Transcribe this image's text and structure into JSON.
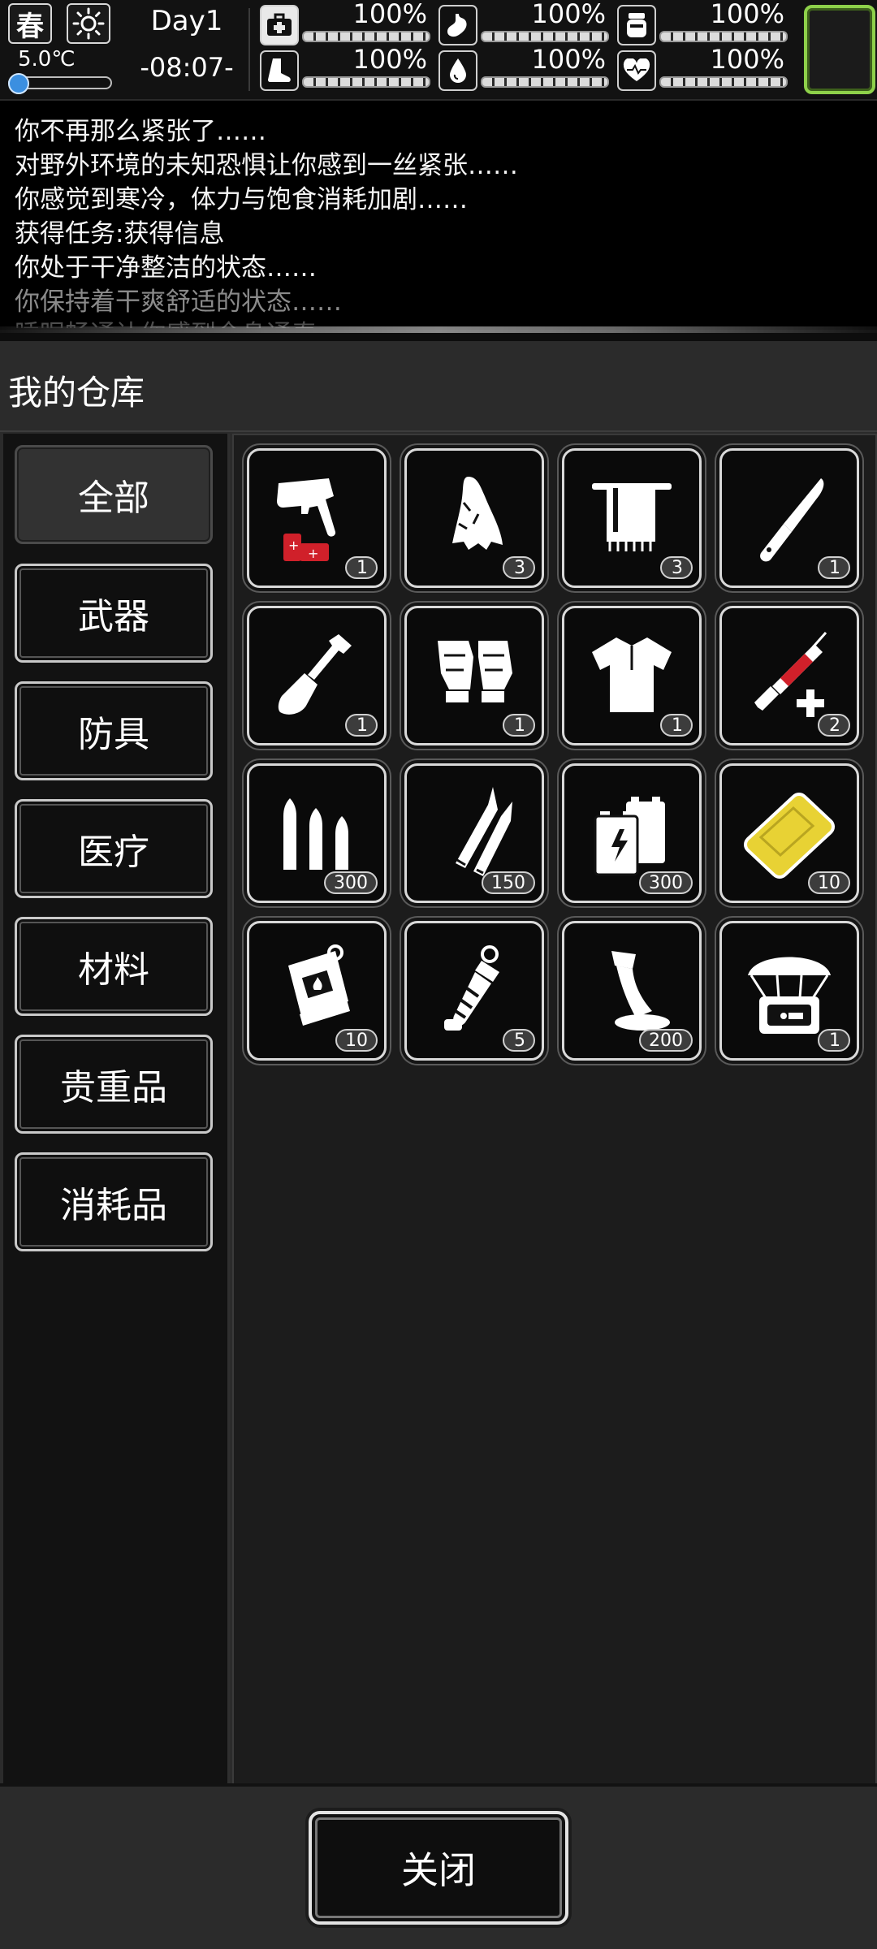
{
  "status": {
    "season": "春",
    "weather_icon": "sun-icon",
    "temperature": "5.0℃",
    "temperature_level": 0.18,
    "day": "Day1",
    "time": "-08:07-",
    "stats": [
      {
        "icon": "first-aid-icon",
        "value": "100%"
      },
      {
        "icon": "stomach-icon",
        "value": "100%"
      },
      {
        "icon": "jar-icon",
        "value": "100%"
      },
      {
        "icon": "boot-icon",
        "value": "100%"
      },
      {
        "icon": "water-drop-icon",
        "value": "100%"
      },
      {
        "icon": "heart-icon",
        "value": "100%"
      }
    ]
  },
  "log": [
    "你不再那么紧张了……",
    "对野外环境的未知恐惧让你感到一丝紧张……",
    "你感觉到寒冷，体力与饱食消耗加剧……",
    "获得任务:获得信息",
    "你处于干净整洁的状态……",
    "你保持着干爽舒适的状态……",
    "睡眠畅通让你感到全身通泰"
  ],
  "warehouse": {
    "title": "我的仓库",
    "categories": [
      "全部",
      "武器",
      "防具",
      "医疗",
      "材料",
      "贵重品",
      "消耗品"
    ],
    "active_category": "全部",
    "items": [
      {
        "icon": "flare-gun-icon",
        "qty": "1"
      },
      {
        "icon": "torn-cloth-icon",
        "qty": "3"
      },
      {
        "icon": "towel-icon",
        "qty": "3"
      },
      {
        "icon": "knife-icon",
        "qty": "1"
      },
      {
        "icon": "shovel-icon",
        "qty": "1"
      },
      {
        "icon": "gloves-icon",
        "qty": "1"
      },
      {
        "icon": "shirt-icon",
        "qty": "1"
      },
      {
        "icon": "syringe-icon",
        "qty": "2"
      },
      {
        "icon": "bullets-icon",
        "qty": "300"
      },
      {
        "icon": "rifle-rounds-icon",
        "qty": "150"
      },
      {
        "icon": "battery-icon",
        "qty": "300"
      },
      {
        "icon": "gold-bar-icon",
        "qty": "10"
      },
      {
        "icon": "fuel-can-icon",
        "qty": "10"
      },
      {
        "icon": "grenade-icon",
        "qty": "5"
      },
      {
        "icon": "glue-icon",
        "qty": "200"
      },
      {
        "icon": "airdrop-crate-icon",
        "qty": "1"
      }
    ],
    "close_label": "关闭"
  },
  "colors": {
    "accent_green": "#8ed14a",
    "temp_blue": "#3b8fe0",
    "syringe_red": "#d0202a",
    "gold": "#e8d234"
  }
}
